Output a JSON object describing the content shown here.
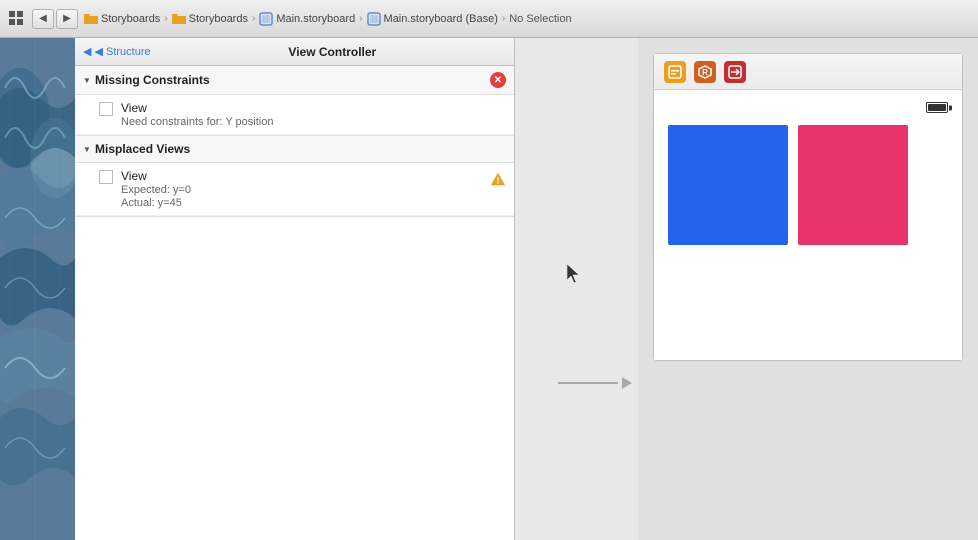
{
  "toolbar": {
    "back_label": "◀",
    "forward_label": "▶",
    "breadcrumb": [
      {
        "id": "storyboards1",
        "label": "Storyboards",
        "type": "folder",
        "icon": "folder"
      },
      {
        "id": "storyboards2",
        "label": "Storyboards",
        "type": "folder",
        "icon": "folder"
      },
      {
        "id": "main_storyboard",
        "label": "Main.storyboard",
        "type": "file",
        "icon": "storyboard"
      },
      {
        "id": "main_storyboard_base",
        "label": "Main.storyboard (Base)",
        "type": "file",
        "icon": "storyboard"
      },
      {
        "id": "no_selection",
        "label": "No Selection",
        "type": "text"
      }
    ],
    "grid_icon": "▦"
  },
  "issue_panel": {
    "back_label": "◀  Structure",
    "title": "View Controller",
    "sections": [
      {
        "id": "missing_constraints",
        "label": "Missing Constraints",
        "type": "error",
        "badge": "✕",
        "items": [
          {
            "name": "View",
            "description": "Need constraints for: Y position"
          }
        ]
      },
      {
        "id": "misplaced_views",
        "label": "Misplaced Views",
        "type": "warning",
        "items": [
          {
            "name": "View",
            "expected": "Expected: y=0",
            "actual": "Actual: y=45"
          }
        ]
      }
    ]
  },
  "canvas": {
    "iphone_icons": [
      {
        "id": "vc-yellow",
        "symbol": "□",
        "class": "vc-icon-yellow",
        "label": "view-controller-icon"
      },
      {
        "id": "vc-orange",
        "symbol": "⬡",
        "class": "vc-icon-orange",
        "label": "first-responder-icon"
      },
      {
        "id": "vc-red",
        "symbol": "⊟",
        "class": "vc-icon-red",
        "label": "exit-icon"
      }
    ],
    "views": [
      {
        "id": "blue-view",
        "color": "#2563eb",
        "label": "blue-view"
      },
      {
        "id": "pink-view",
        "color": "#e8336a",
        "label": "pink-view"
      }
    ]
  }
}
